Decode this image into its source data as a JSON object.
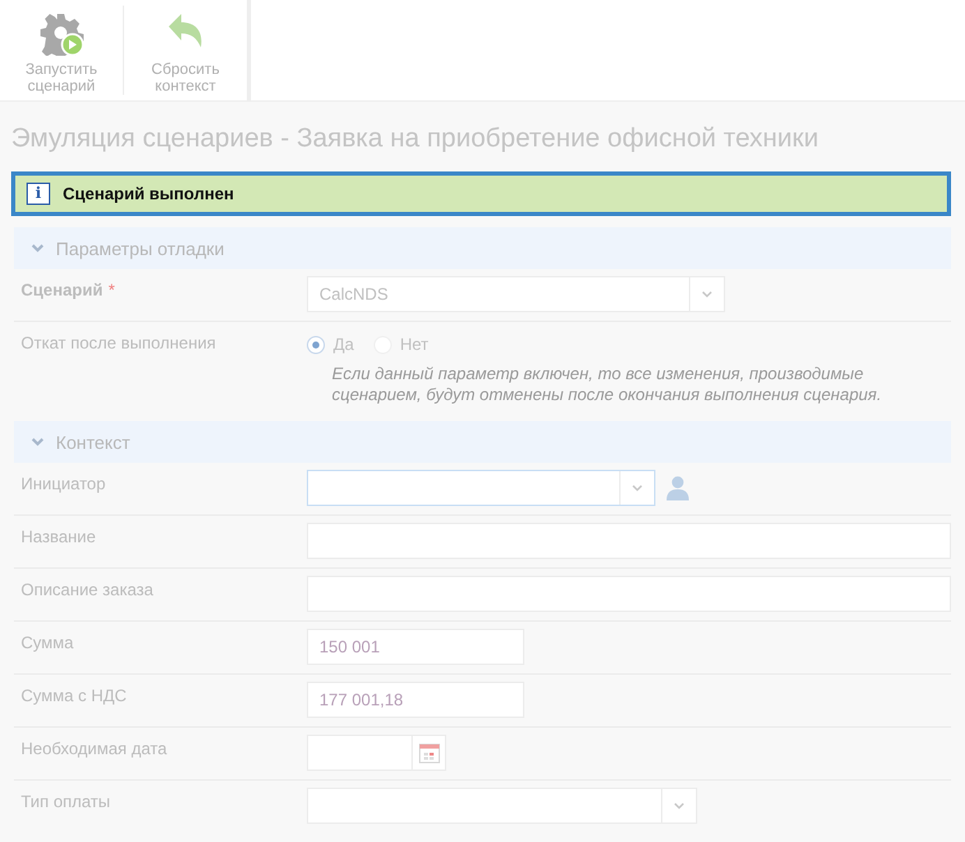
{
  "toolbar": [
    {
      "kind": "run",
      "label": "Запустить сценарий"
    },
    {
      "kind": "reset",
      "label": "Сбросить контекст"
    }
  ],
  "title": "Эмуляция сценариев - Заявка на приобретение офисной техники",
  "alert": {
    "kind": "info",
    "icon": "i",
    "text": "Сценарий выполнен"
  },
  "sections": [
    {
      "title": "Параметры отладки",
      "expanded": true,
      "rows": [
        {
          "label": "Сценарий",
          "required_mark": "*",
          "kind": "select",
          "value": "CalcNDS",
          "focused": false
        },
        {
          "label": "Откат после выполнения",
          "kind": "radio",
          "options": [
            {
              "label": "Да",
              "selected": true
            },
            {
              "label": "Нет",
              "selected": false
            }
          ],
          "hint": "Если данный параметр включен, то все изменения, производимые сценарием, будут отменены после окончания выполнения сценария."
        }
      ]
    },
    {
      "title": "Контекст",
      "expanded": true,
      "rows": [
        {
          "label": "Инициатор",
          "kind": "lookup",
          "focused": true
        },
        {
          "label": "Название",
          "kind": "text",
          "focused": false
        },
        {
          "label": "Описание заказа",
          "kind": "text",
          "focused": false
        },
        {
          "label": "Сумма",
          "kind": "number",
          "value": "150 001",
          "focused": false
        },
        {
          "label": "Сумма с НДС",
          "kind": "number",
          "value": "177 001,18",
          "focused": false
        },
        {
          "label": "Необходимая дата",
          "kind": "date",
          "focused": false
        },
        {
          "label": "Тип оплаты",
          "kind": "select",
          "focused": false
        }
      ]
    }
  ]
}
